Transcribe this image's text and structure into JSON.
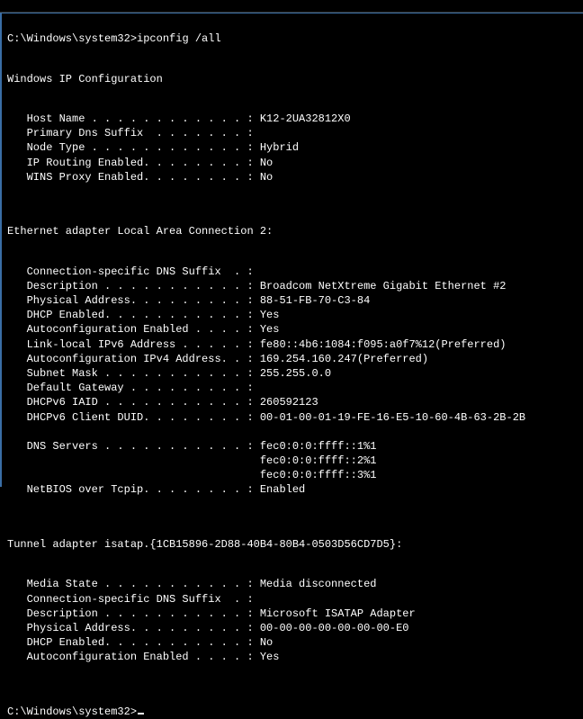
{
  "prompt1": "C:\\Windows\\system32>",
  "command": "ipconfig /all",
  "header": "Windows IP Configuration",
  "global": [
    "   Host Name . . . . . . . . . . . . : K12-2UA32812X0",
    "   Primary Dns Suffix  . . . . . . . :",
    "   Node Type . . . . . . . . . . . . : Hybrid",
    "   IP Routing Enabled. . . . . . . . : No",
    "   WINS Proxy Enabled. . . . . . . . : No"
  ],
  "eth_header": "Ethernet adapter Local Area Connection 2:",
  "eth": [
    "   Connection-specific DNS Suffix  . :",
    "   Description . . . . . . . . . . . : Broadcom NetXtreme Gigabit Ethernet #2",
    "   Physical Address. . . . . . . . . : 88-51-FB-70-C3-84",
    "   DHCP Enabled. . . . . . . . . . . : Yes",
    "   Autoconfiguration Enabled . . . . : Yes",
    "   Link-local IPv6 Address . . . . . : fe80::4b6:1084:f095:a0f7%12(Preferred)",
    "   Autoconfiguration IPv4 Address. . : 169.254.160.247(Preferred)",
    "   Subnet Mask . . . . . . . . . . . : 255.255.0.0",
    "   Default Gateway . . . . . . . . . :",
    "   DHCPv6 IAID . . . . . . . . . . . : 260592123",
    "   DHCPv6 Client DUID. . . . . . . . : 00-01-00-01-19-FE-16-E5-10-60-4B-63-2B-2B",
    "",
    "   DNS Servers . . . . . . . . . . . : fec0:0:0:ffff::1%1",
    "                                       fec0:0:0:ffff::2%1",
    "                                       fec0:0:0:ffff::3%1",
    "   NetBIOS over Tcpip. . . . . . . . : Enabled"
  ],
  "tun_header": "Tunnel adapter isatap.{1CB15896-2D88-40B4-80B4-0503D56CD7D5}:",
  "tun": [
    "   Media State . . . . . . . . . . . : Media disconnected",
    "   Connection-specific DNS Suffix  . :",
    "   Description . . . . . . . . . . . : Microsoft ISATAP Adapter",
    "   Physical Address. . . . . . . . . : 00-00-00-00-00-00-00-E0",
    "   DHCP Enabled. . . . . . . . . . . : No",
    "   Autoconfiguration Enabled . . . . : Yes"
  ],
  "prompt2": "C:\\Windows\\system32>"
}
